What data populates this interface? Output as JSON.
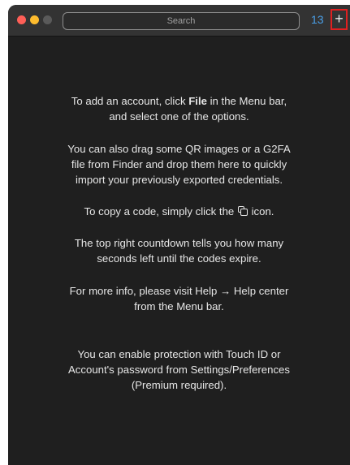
{
  "titlebar": {
    "search_placeholder": "Search",
    "countdown": "13",
    "add_label": "+"
  },
  "instructions": {
    "p1": {
      "l1_pre": "To add an account, click ",
      "l1_bold": "File",
      "l1_post": " in the Menu bar,",
      "l2": "and select one of the options."
    },
    "p2": {
      "l1": "You can also drag some QR images or a G2FA",
      "l2": "file from Finder and drop them here to quickly",
      "l3": "import your previously exported credentials."
    },
    "p3": {
      "pre": "To copy a code, simply click the ",
      "icon": "copy-icon",
      "post": " icon."
    },
    "p4": {
      "l1": "The top right countdown tells you how many",
      "l2": "seconds left until the codes expire."
    },
    "p5": {
      "l1": "For more info, please visit Help → Help center",
      "l2": "from the Menu bar."
    },
    "p6": {
      "l1": "You can enable protection with Touch ID or",
      "l2": "Account's password from Settings/Preferences",
      "l3": "(Premium required)."
    }
  },
  "colors": {
    "close": "#fe5f57",
    "minimize": "#febc2e",
    "countdown": "#4a9fe8",
    "highlight_border": "#e02020",
    "background": "#1f1f1f"
  }
}
